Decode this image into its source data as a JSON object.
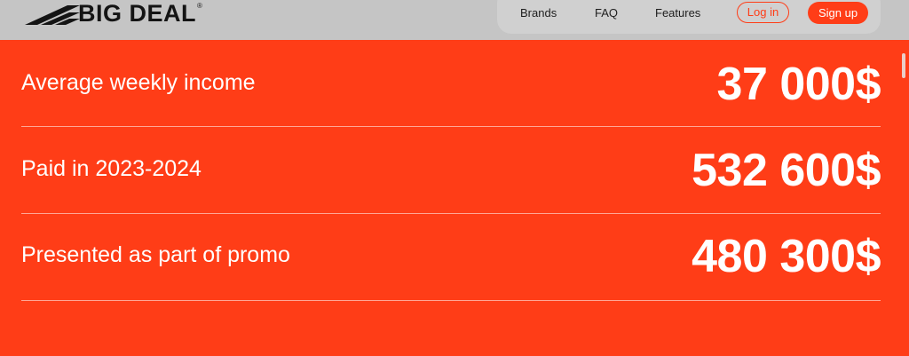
{
  "header": {
    "logo_text": "BIG DEAL",
    "logo_reg": "®",
    "nav": [
      {
        "label": "Brands"
      },
      {
        "label": "FAQ"
      },
      {
        "label": "Features"
      }
    ],
    "login_label": "Log in",
    "signup_label": "Sign up"
  },
  "stats": [
    {
      "label": "Average weekly income",
      "value": "37 000$"
    },
    {
      "label": "Paid in 2023-2024",
      "value": "532 600$"
    },
    {
      "label": "Presented as part of promo",
      "value": "480 300$"
    }
  ],
  "colors": {
    "accent": "#ff3d17",
    "header_bg": "#c5c5c5",
    "nav_bg": "#d0d0d0",
    "text_on_accent": "#ffffff"
  }
}
